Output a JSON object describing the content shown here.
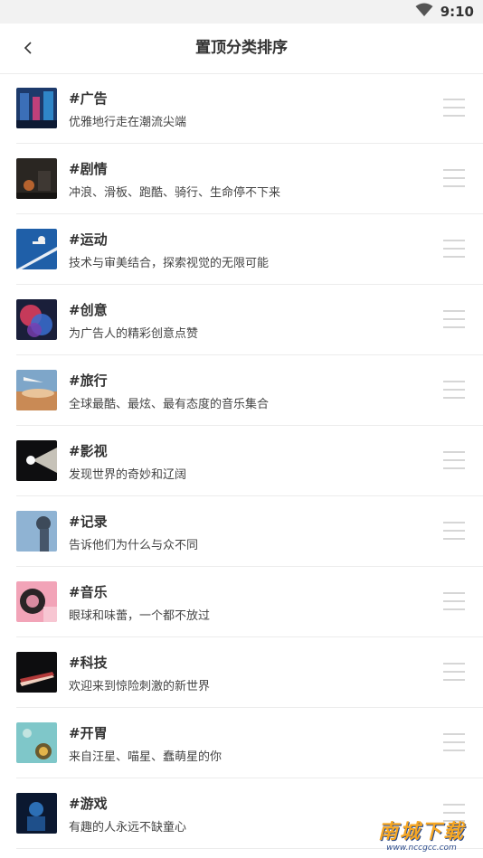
{
  "status_bar": {
    "time": "9:10",
    "wifi_icon": "wifi-icon"
  },
  "nav": {
    "title": "置顶分类排序",
    "back_icon": "chevron-left-icon"
  },
  "items": [
    {
      "title": "#广告",
      "desc": "优雅地行走在潮流尖端"
    },
    {
      "title": "#剧情",
      "desc": "冲浪、滑板、跑酷、骑行、生命停不下来"
    },
    {
      "title": "#运动",
      "desc": "技术与审美结合，探索视觉的无限可能"
    },
    {
      "title": "#创意",
      "desc": "为广告人的精彩创意点赞"
    },
    {
      "title": "#旅行",
      "desc": "全球最酷、最炫、最有态度的音乐集合"
    },
    {
      "title": "#影视",
      "desc": "发现世界的奇妙和辽阔"
    },
    {
      "title": "#记录",
      "desc": "告诉他们为什么与众不同"
    },
    {
      "title": "#音乐",
      "desc": "眼球和味蕾，一个都不放过"
    },
    {
      "title": "#科技",
      "desc": "欢迎来到惊险刺激的新世界"
    },
    {
      "title": "#开胃",
      "desc": "来自汪星、喵星、蠢萌星的你"
    },
    {
      "title": "#游戏",
      "desc": "有趣的人永远不缺童心"
    }
  ],
  "watermark": {
    "main": "南城下载",
    "sub": "www.nccgcc.com"
  }
}
